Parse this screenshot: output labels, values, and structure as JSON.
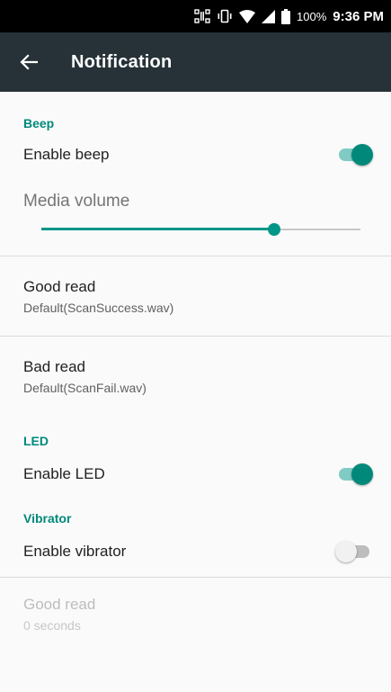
{
  "status_bar": {
    "battery": "100%",
    "time": "9:36 PM",
    "icons": [
      "scanner-icon",
      "vibrate-icon",
      "wifi-icon",
      "signal-icon",
      "battery-icon"
    ]
  },
  "app_bar": {
    "back_icon": "arrow-back-icon",
    "title": "Notification"
  },
  "beep": {
    "header": "Beep",
    "enable_label": "Enable beep",
    "enable_on": true,
    "media_volume_label": "Media volume",
    "media_volume_level": 0.73,
    "good_read": {
      "title": "Good read",
      "summary": "Default(ScanSuccess.wav)"
    },
    "bad_read": {
      "title": "Bad read",
      "summary": "Default(ScanFail.wav)"
    }
  },
  "led": {
    "header": "LED",
    "enable_label": "Enable LED",
    "enable_on": true
  },
  "vibrator": {
    "header": "Vibrator",
    "enable_label": "Enable vibrator",
    "enable_on": false,
    "good_read": {
      "title": "Good read",
      "summary": "0 seconds"
    }
  },
  "colors": {
    "accent": "#00897b",
    "app_bar": "#263238",
    "status_bar": "#000000"
  }
}
